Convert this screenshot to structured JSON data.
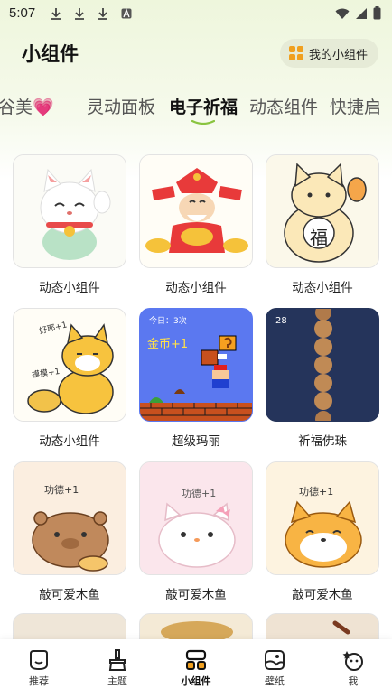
{
  "status": {
    "time": "5:07"
  },
  "header": {
    "title": "小组件",
    "my_widgets_label": "我的小组件"
  },
  "tabs": [
    {
      "label": "谷美💗"
    },
    {
      "label": "灵动面板"
    },
    {
      "label": "电子祈福"
    },
    {
      "label": "动态组件"
    },
    {
      "label": "快捷启"
    }
  ],
  "grid": {
    "items": [
      {
        "label": "动态小组件"
      },
      {
        "label": "动态小组件"
      },
      {
        "label": "动态小组件"
      },
      {
        "label": "动态小组件"
      },
      {
        "label": "超级玛丽",
        "overlay": "今日：3次",
        "score": "金币+1"
      },
      {
        "label": "祈福佛珠",
        "count": "28"
      },
      {
        "label": "敲可爱木鱼",
        "merit": "功德+1"
      },
      {
        "label": "敲可爱木鱼",
        "merit": "功德+1"
      },
      {
        "label": "敲可爱木鱼",
        "merit": "功德+1"
      }
    ]
  },
  "cat_sign": "福",
  "hand_text": [
    "好耶+1",
    "摸摸+1"
  ],
  "bottom_nav": [
    {
      "label": "推荐"
    },
    {
      "label": "主题"
    },
    {
      "label": "小组件"
    },
    {
      "label": "壁纸"
    },
    {
      "label": "我"
    }
  ]
}
